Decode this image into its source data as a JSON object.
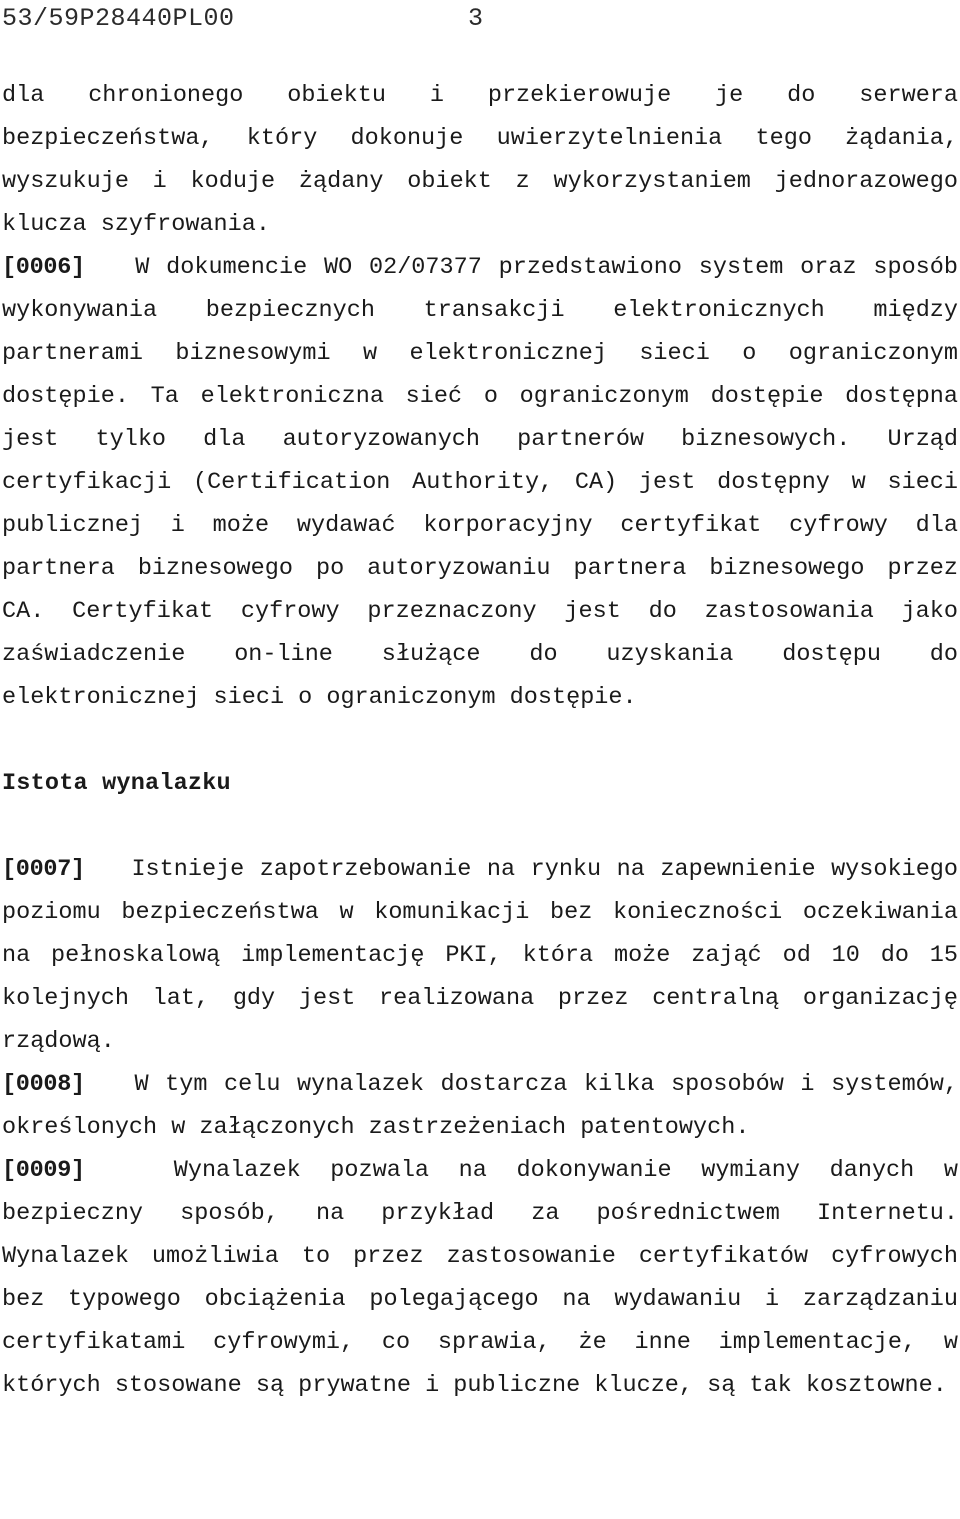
{
  "document": {
    "language": "pl",
    "header": {
      "reference": "53/59P28440PL00",
      "page_number": "3"
    },
    "section_heading": "Istota wynalazku",
    "paragraphs": [
      {
        "marker": "",
        "text": "dla chronionego obiektu i przekierowuje je do serwera bezpieczeństwa, który dokonuje uwierzytelnienia tego żądania, wyszukuje i koduje żądany obiekt z wykorzystaniem jednorazowego klucza szyfrowania."
      },
      {
        "marker": "[0006]",
        "text": "W dokumencie WO 02/07377 przedstawiono system oraz sposób wykonywania bezpiecznych transakcji elektronicznych między partnerami biznesowymi w elektronicznej sieci o ograniczonym dostępie. Ta elektroniczna sieć o ograniczonym dostępie dostępna jest tylko dla autoryzowanych partnerów biznesowych. Urząd certyfikacji (Certification Authority, CA) jest dostępny w sieci publicznej i może wydawać korporacyjny certyfikat cyfrowy dla partnera biznesowego po autoryzowaniu partnera biznesowego przez CA. Certyfikat cyfrowy przeznaczony jest do zastosowania jako zaświadczenie on-line służące do uzyskania dostępu do elektronicznej sieci o ograniczonym dostępie."
      },
      {
        "marker": "[0007]",
        "text": "Istnieje zapotrzebowanie na rynku na zapewnienie wysokiego poziomu bezpieczeństwa w komunikacji bez konieczności oczekiwania na pełnoskalową implementację PKI, która może zająć od 10 do 15 kolejnych lat, gdy jest realizowana przez centralną organizację rządową."
      },
      {
        "marker": "[0008]",
        "text": "W tym celu wynalazek dostarcza kilka sposobów i systemów, określonych w załączonych zastrzeżeniach patentowych."
      },
      {
        "marker": "[0009]",
        "text": "Wynalazek pozwala na dokonywanie wymiany danych w bezpieczny sposób, na przykład za pośrednictwem Internetu. Wynalazek umożliwia to przez zastosowanie certyfikatów cyfrowych bez typowego obciążenia polegającego na wydawaniu i zarządzaniu certyfikatami cyfrowymi, co sprawia, że inne implementacje, w których stosowane są prywatne i publiczne klucze, są tak kosztowne."
      }
    ]
  }
}
